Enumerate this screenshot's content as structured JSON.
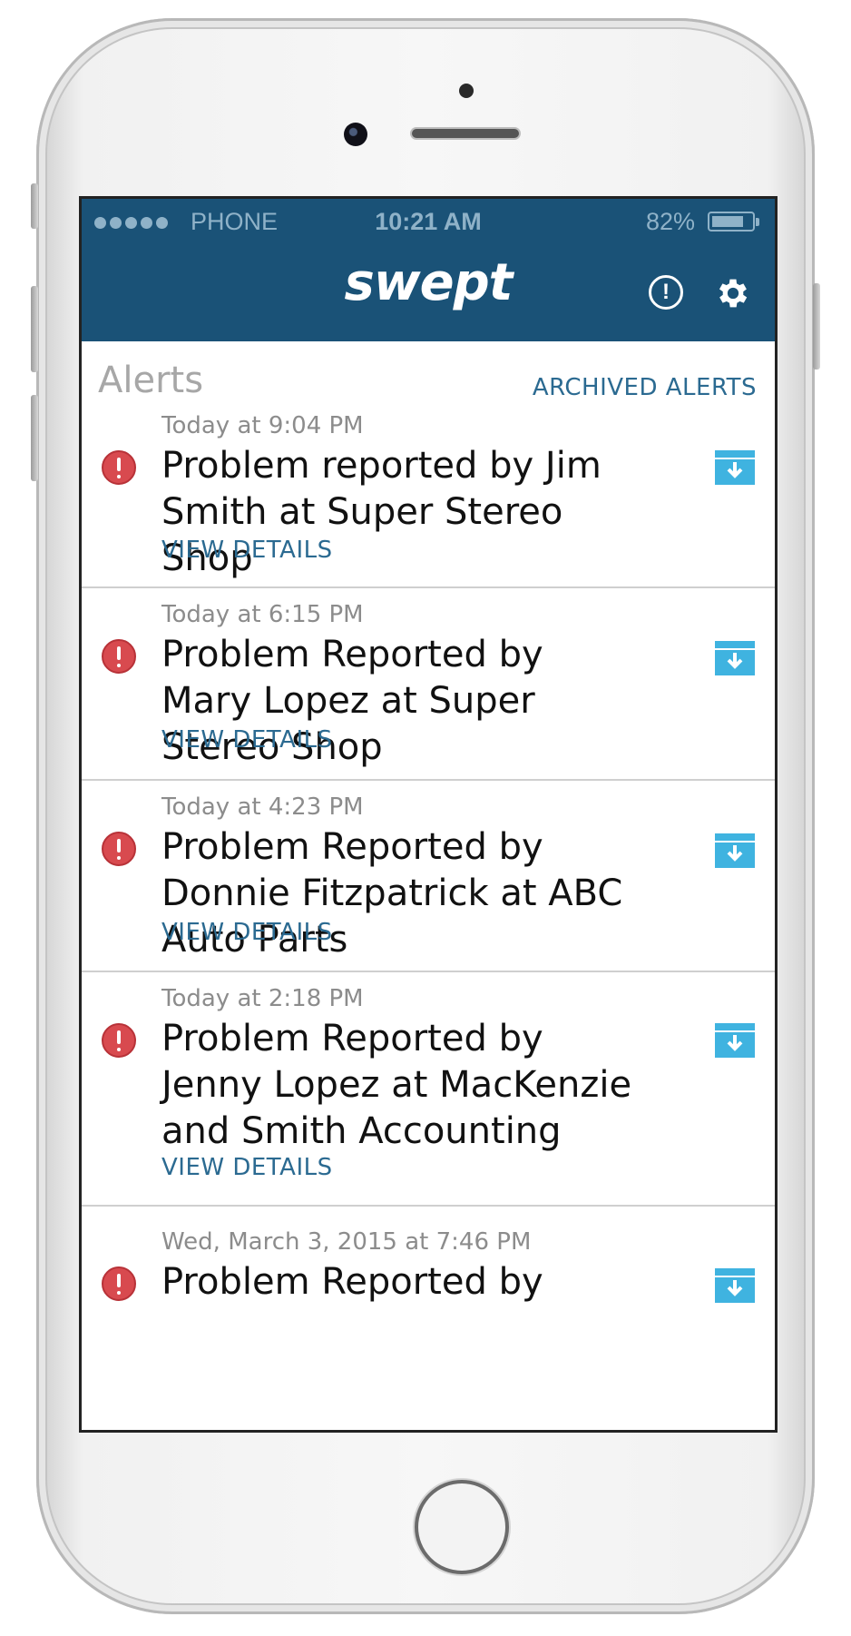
{
  "status_bar": {
    "carrier": "PHONE",
    "time": "10:21 AM",
    "battery": "82%",
    "battery_level": 0.82
  },
  "app": {
    "logo": "swept",
    "alert_icon": "alert-circle-icon",
    "settings_icon": "gear-icon"
  },
  "alerts_page": {
    "heading": "Alerts",
    "archived_link": "ARCHIVED ALERTS",
    "items": [
      {
        "time": "Today at 9:04 PM",
        "title": "Problem reported by Jim Smith at Super Stereo Shop",
        "details": "VIEW DETAILS"
      },
      {
        "time": "Today at 6:15 PM",
        "title": "Problem Reported by Mary Lopez at Super Stereo Shop",
        "details": "VIEW DETAILS"
      },
      {
        "time": "Today at 4:23 PM",
        "title": "Problem Reported by Donnie Fitzpatrick at ABC Auto Parts",
        "details": "VIEW DETAILS"
      },
      {
        "time": "Today at 2:18 PM",
        "title": "Problem Reported by Jenny Lopez at MacKenzie and Smith Accounting",
        "details": "VIEW DETAILS"
      },
      {
        "time": "Wed, March 3, 2015 at 7:46 PM",
        "title": "Problem Reported by"
      }
    ]
  },
  "colors": {
    "header": "#1a5277",
    "link": "#2b6a91",
    "error": "#d84a4f",
    "archive": "#3fb3e0"
  }
}
